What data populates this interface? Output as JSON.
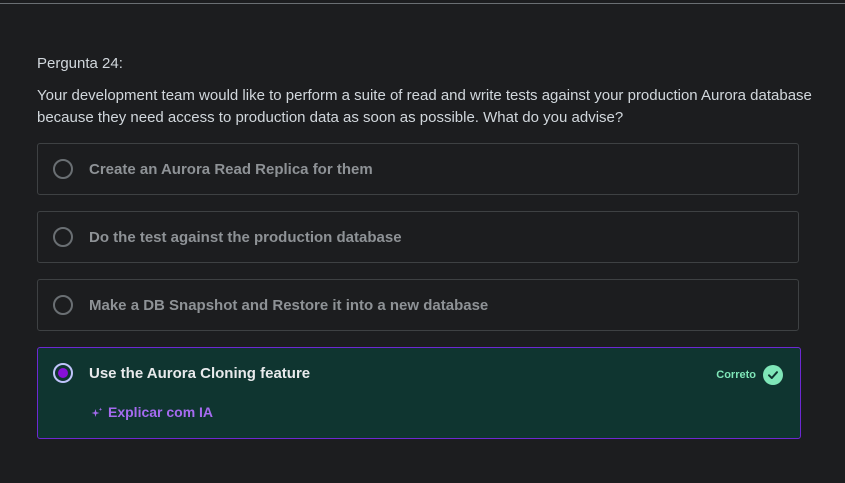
{
  "question": {
    "number_label": "Pergunta 24:",
    "text": "Your development team would like to perform a suite of read and write tests against your production Aurora database because they need access to production data as soon as possible. What do you advise?"
  },
  "options": [
    {
      "label": "Create an Aurora Read Replica for them",
      "selected": false
    },
    {
      "label": "Do the test against the production database",
      "selected": false
    },
    {
      "label": "Make a DB Snapshot and Restore it into a new database",
      "selected": false
    },
    {
      "label": "Use the Aurora Cloning feature",
      "selected": true
    }
  ],
  "result": {
    "status_label": "Correto",
    "explain_label": "Explicar com IA"
  },
  "colors": {
    "background": "#1c1d1f",
    "correct_bg": "#0f3530",
    "correct_border": "#6d28d2",
    "correct_text": "#7fe6b8",
    "accent_purple": "#a56bf0",
    "radio_selected": "#8710d8"
  },
  "icons": {
    "check": "check-circle-icon",
    "sparkle": "sparkle-icon",
    "radio": "radio-button"
  }
}
